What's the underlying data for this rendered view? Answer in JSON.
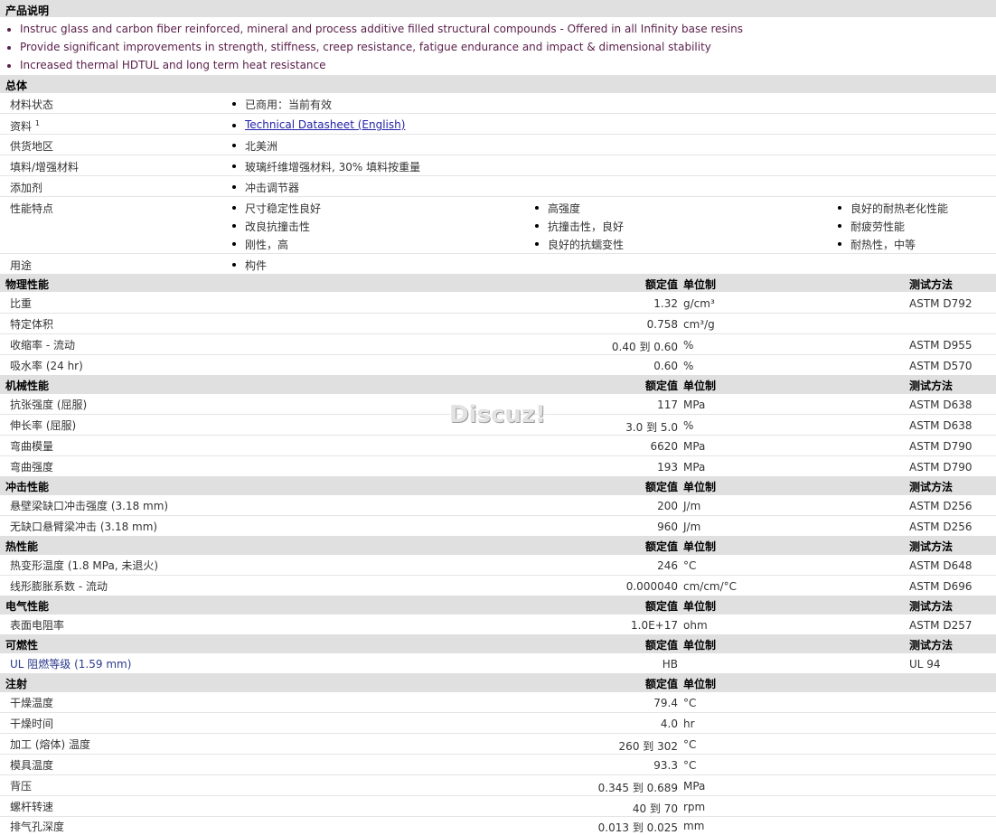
{
  "description": {
    "header": "产品说明",
    "items": [
      "Instruc glass and carbon fiber reinforced, mineral and process additive filled structural compounds - Offered in all Infinity base resins",
      "Provide significant improvements in strength, stiffness, creep resistance, fatigue endurance and impact & dimensional stability",
      "Increased thermal HDTUL and long term heat resistance"
    ]
  },
  "general": {
    "header": "总体",
    "status": {
      "label": "材料状态",
      "value": "已商用：当前有效"
    },
    "docs": {
      "label": "资料",
      "sup": "1",
      "link": "Technical Datasheet (English)"
    },
    "region": {
      "label": "供货地区",
      "value": "北美洲"
    },
    "filler": {
      "label": "填料/增强材料",
      "value": "玻璃纤维增强材料, 30% 填料按重量"
    },
    "additive": {
      "label": "添加剂",
      "value": "冲击调节器"
    },
    "features": {
      "label": "性能特点",
      "values": [
        "尺寸稳定性良好",
        "高强度",
        "良好的耐热老化性能",
        "改良抗撞击性",
        "抗撞击性，良好",
        "耐疲劳性能",
        "刚性，高",
        "良好的抗蠕变性",
        "耐热性，中等"
      ]
    },
    "uses": {
      "label": "用途",
      "value": "构件"
    }
  },
  "col_headers": {
    "value": "额定值",
    "unit": "单位制",
    "method": "测试方法"
  },
  "physical": {
    "header": "物理性能",
    "rows": [
      {
        "label": "比重",
        "value": "1.32",
        "unit": "g/cm³",
        "method": "ASTM D792"
      },
      {
        "label": "特定体积",
        "value": "0.758",
        "unit": "cm³/g",
        "method": ""
      },
      {
        "label": "收缩率 - 流动",
        "value": "0.40 到 0.60",
        "unit": "%",
        "method": "ASTM D955"
      },
      {
        "label": "吸水率 (24 hr)",
        "value": "0.60",
        "unit": "%",
        "method": "ASTM D570"
      }
    ]
  },
  "mechanical": {
    "header": "机械性能",
    "rows": [
      {
        "label": "抗张强度 (屈服)",
        "value": "117",
        "unit": "MPa",
        "method": "ASTM D638"
      },
      {
        "label": "伸长率 (屈服)",
        "value": "3.0 到 5.0",
        "unit": "%",
        "method": "ASTM D638"
      },
      {
        "label": "弯曲模量",
        "value": "6620",
        "unit": "MPa",
        "method": "ASTM D790"
      },
      {
        "label": "弯曲强度",
        "value": "193",
        "unit": "MPa",
        "method": "ASTM D790"
      }
    ]
  },
  "impact": {
    "header": "冲击性能",
    "rows": [
      {
        "label": "悬壁梁缺口冲击强度 (3.18 mm)",
        "value": "200",
        "unit": "J/m",
        "method": "ASTM D256"
      },
      {
        "label": "无缺口悬臂梁冲击 (3.18 mm)",
        "value": "960",
        "unit": "J/m",
        "method": "ASTM D256"
      }
    ]
  },
  "thermal": {
    "header": "热性能",
    "rows": [
      {
        "label": "热变形温度 (1.8 MPa, 未退火)",
        "value": "246",
        "unit": "°C",
        "method": "ASTM D648"
      },
      {
        "label": "线形膨胀系数 - 流动",
        "value": "0.000040",
        "unit": "cm/cm/°C",
        "method": "ASTM D696"
      }
    ]
  },
  "electrical": {
    "header": "电气性能",
    "rows": [
      {
        "label": "表面电阻率",
        "value": "1.0E+17",
        "unit": "ohm",
        "method": "ASTM D257"
      }
    ]
  },
  "flammability": {
    "header": "可燃性",
    "rows": [
      {
        "label": "UL 阻燃等级 (1.59 mm)",
        "value": "HB",
        "unit": "",
        "method": "UL 94"
      }
    ]
  },
  "injection": {
    "header": "注射",
    "rows": [
      {
        "label": "干燥温度",
        "value": "79.4",
        "unit": "°C",
        "method": ""
      },
      {
        "label": "干燥时间",
        "value": "4.0",
        "unit": "hr",
        "method": ""
      },
      {
        "label": "加工 (熔体) 温度",
        "value": "260 到 302",
        "unit": "°C",
        "method": ""
      },
      {
        "label": "模具温度",
        "value": "93.3",
        "unit": "°C",
        "method": ""
      },
      {
        "label": "背压",
        "value": "0.345 到 0.689",
        "unit": "MPa",
        "method": ""
      },
      {
        "label": "螺杆转速",
        "value": "40 到 70",
        "unit": "rpm",
        "method": ""
      },
      {
        "label": "排气孔深度",
        "value": "0.013 到 0.025",
        "unit": "mm",
        "method": ""
      }
    ]
  },
  "watermark": "Discuz!"
}
